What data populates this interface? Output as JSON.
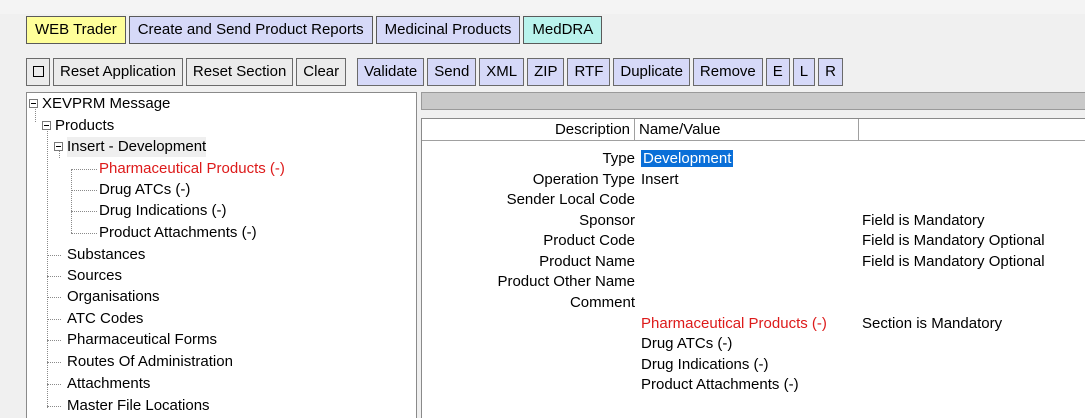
{
  "tabs": [
    {
      "label": "WEB Trader"
    },
    {
      "label": "Create and Send Product Reports"
    },
    {
      "label": "Medicinal Products"
    },
    {
      "label": "MedDRA"
    }
  ],
  "toolbar": {
    "reset_application": "Reset Application",
    "reset_section": "Reset Section",
    "clear": "Clear",
    "validate": "Validate",
    "send": "Send",
    "xml": "XML",
    "zip": "ZIP",
    "rtf": "RTF",
    "duplicate": "Duplicate",
    "remove": "Remove",
    "e": "E",
    "l": "L",
    "r": "R"
  },
  "tree": {
    "root": "XEVPRM Message",
    "products": "Products",
    "insert": "Insert - Development",
    "children": [
      {
        "label": "Pharmaceutical Products (-)"
      },
      {
        "label": "Drug ATCs (-)"
      },
      {
        "label": "Drug Indications (-)"
      },
      {
        "label": "Product Attachments (-)"
      }
    ],
    "top_items": [
      {
        "label": "Substances"
      },
      {
        "label": "Sources"
      },
      {
        "label": "Organisations"
      },
      {
        "label": "ATC Codes"
      },
      {
        "label": "Pharmaceutical Forms"
      },
      {
        "label": "Routes Of Administration"
      },
      {
        "label": "Attachments"
      },
      {
        "label": "Master File Locations"
      }
    ]
  },
  "grid": {
    "col_description": "Description",
    "col_value": "Name/Value",
    "rows": [
      {
        "label": "Type",
        "value": "Development",
        "note": ""
      },
      {
        "label": "Operation Type",
        "value": "Insert",
        "note": ""
      },
      {
        "label": "Sender Local Code",
        "value": "",
        "note": ""
      },
      {
        "label": "Sponsor",
        "value": "",
        "note": "Field is Mandatory"
      },
      {
        "label": "Product Code",
        "value": "",
        "note": "Field is Mandatory Optional"
      },
      {
        "label": "Product Name",
        "value": "",
        "note": "Field is Mandatory Optional"
      },
      {
        "label": "Product Other Name",
        "value": "",
        "note": ""
      },
      {
        "label": "Comment",
        "value": "",
        "note": ""
      }
    ],
    "sections": [
      {
        "label": "Pharmaceutical Products (-)",
        "note": "Section is Mandatory"
      },
      {
        "label": "Drug ATCs (-)",
        "note": ""
      },
      {
        "label": "Drug Indications (-)",
        "note": ""
      },
      {
        "label": "Product Attachments (-)",
        "note": ""
      }
    ]
  },
  "colors": {
    "mandatory_red": "#dd1a1a",
    "selection_blue": "#0a6fd8",
    "tab_yellow": "#ffff99",
    "tab_lavender": "#d6d9f8",
    "tab_cyan": "#b9f3ed"
  }
}
